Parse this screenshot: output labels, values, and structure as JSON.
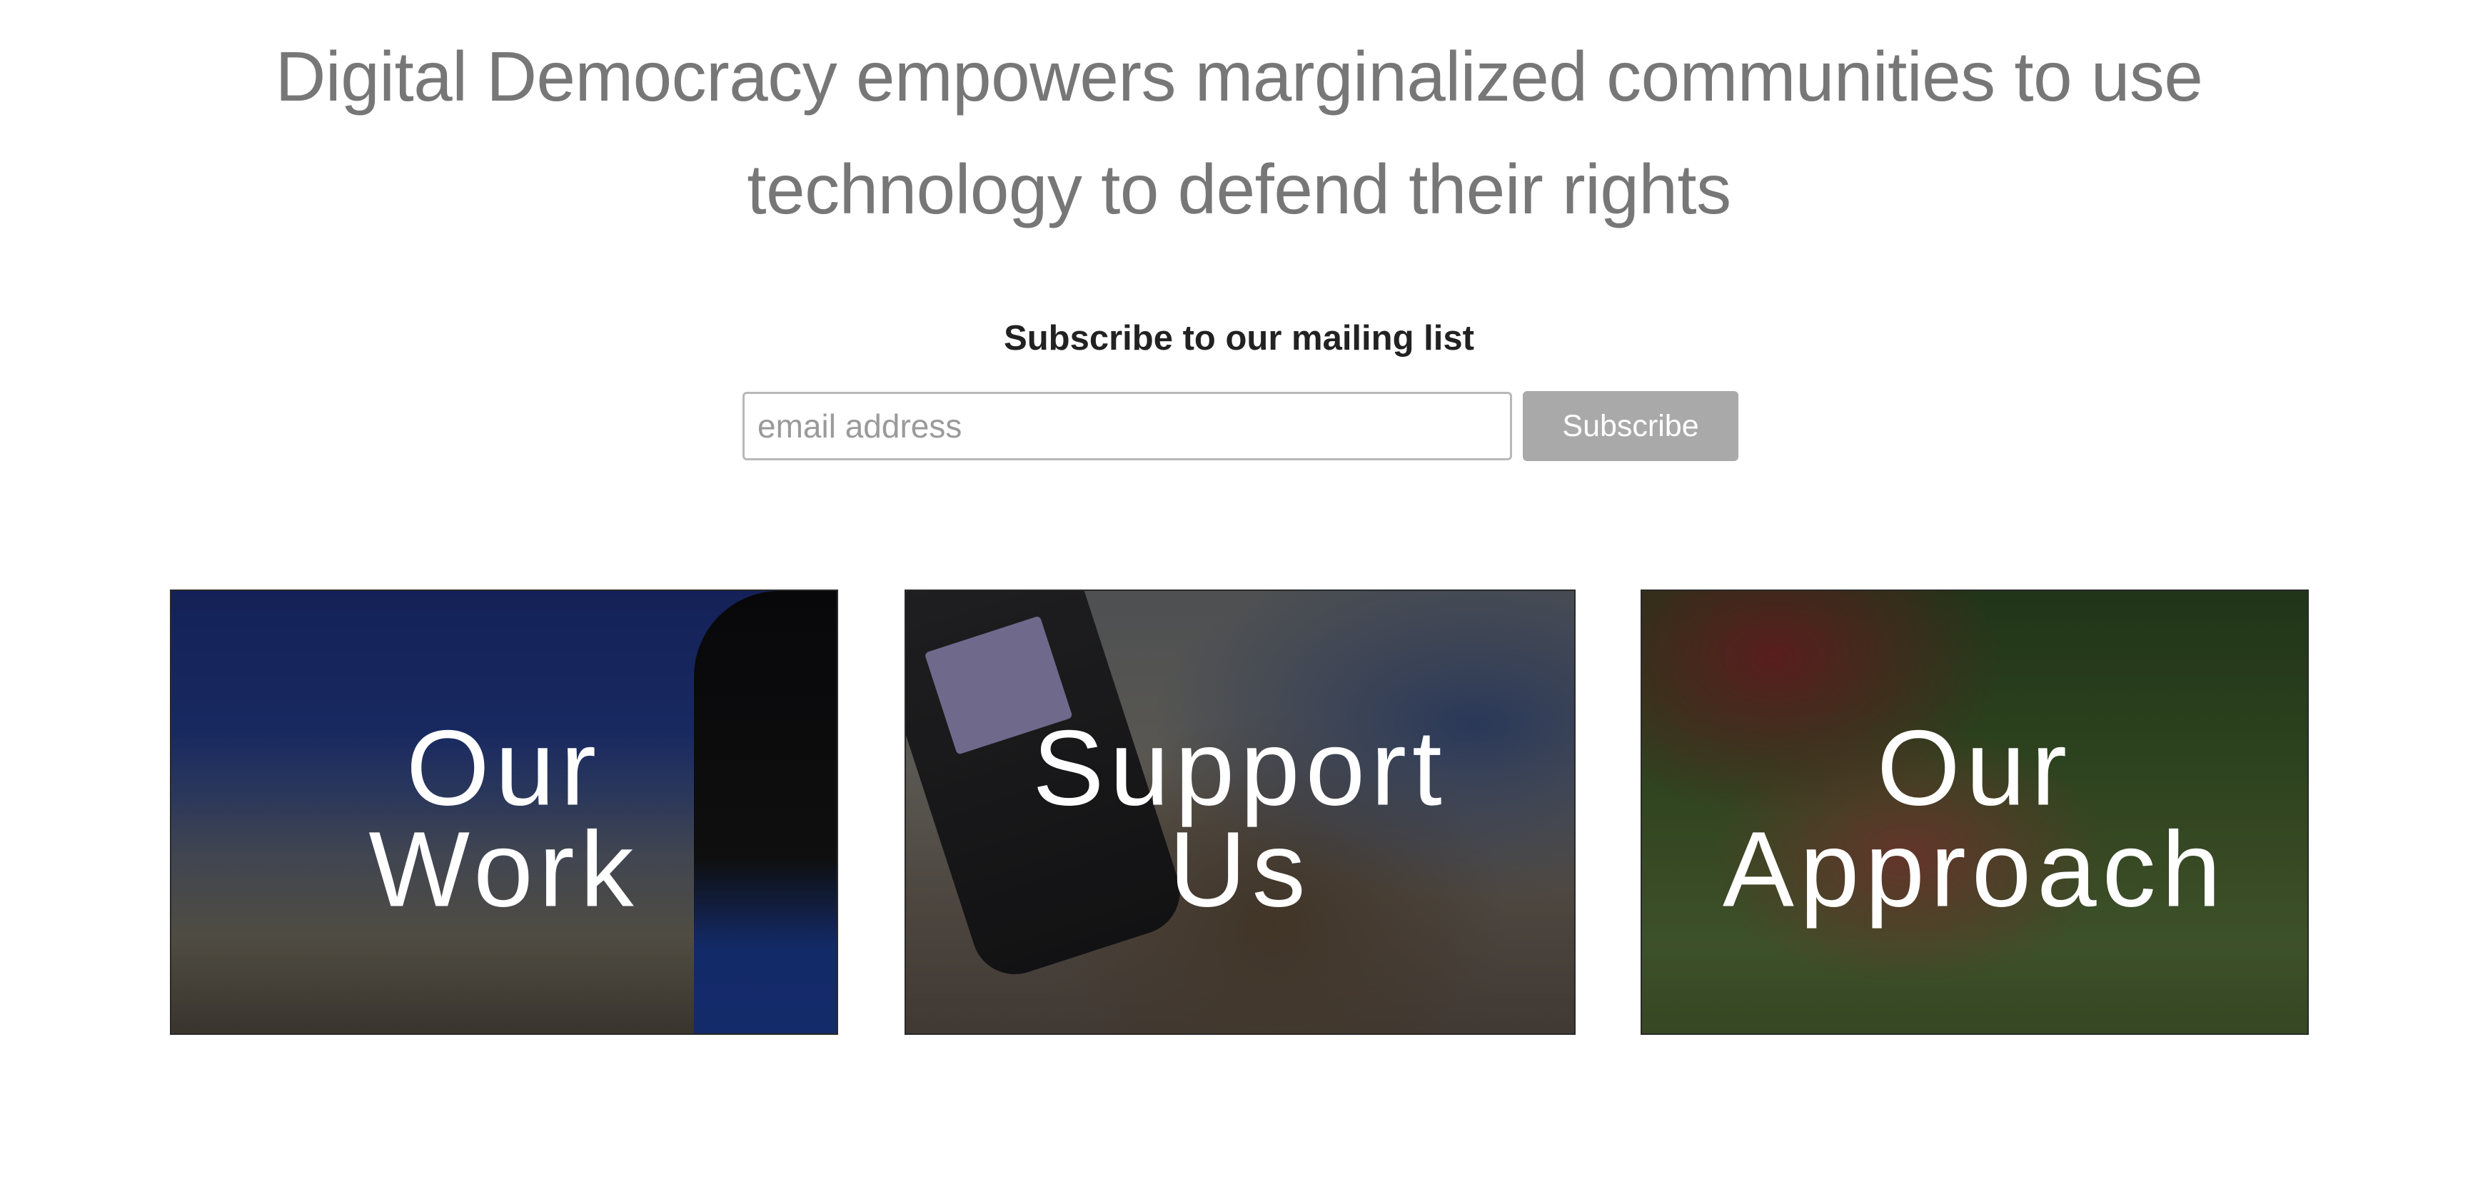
{
  "hero": {
    "tagline_line1": "Digital Democracy empowers marginalized communities to use",
    "tagline_line2": "technology to defend their rights"
  },
  "subscribe": {
    "heading": "Subscribe to our mailing list",
    "email_placeholder": "email address",
    "email_value": "",
    "button_label": "Subscribe"
  },
  "cards": [
    {
      "line1": "Our",
      "line2": "Work"
    },
    {
      "line1": "Support",
      "line2": "Us"
    },
    {
      "line1": "Our",
      "line2": "Approach"
    }
  ],
  "colors": {
    "tagline_text": "#777777",
    "heading_text": "#222222",
    "button_bg": "#a9a9a9",
    "card_label": "#ffffff"
  }
}
